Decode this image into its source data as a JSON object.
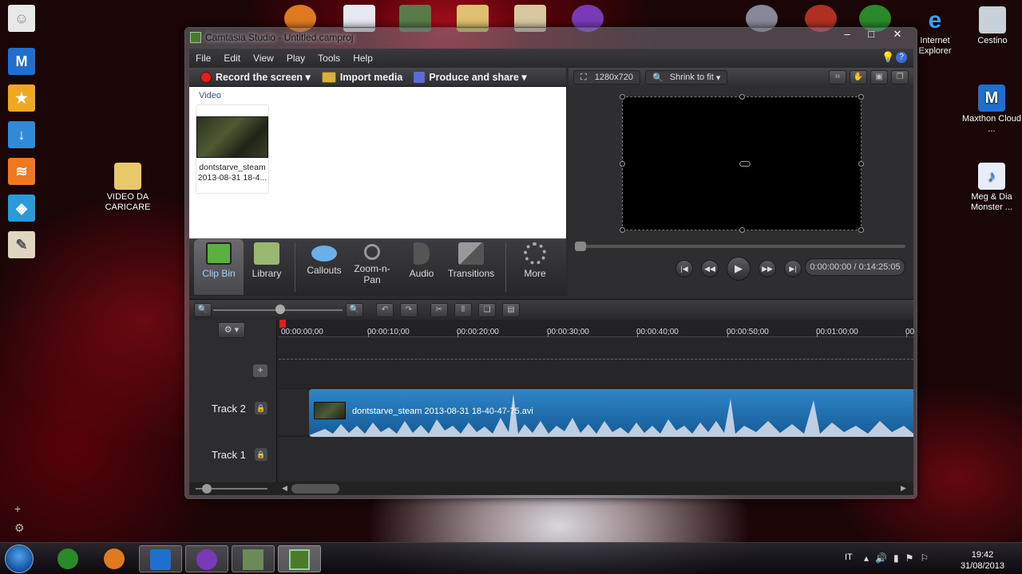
{
  "desktop": {
    "left_icons": [
      {
        "label": "VIDEO DA CARICARE"
      }
    ],
    "right_icons": [
      {
        "label": "Internet Explorer"
      },
      {
        "label": "Cestino"
      },
      {
        "label": "Maxthon Cloud ..."
      },
      {
        "label": "Meg & Dia Monster ..."
      }
    ]
  },
  "window": {
    "title": "Camtasia Studio - Untitled.camproj",
    "menu": [
      "File",
      "Edit",
      "View",
      "Play",
      "Tools",
      "Help"
    ],
    "toolbar": {
      "record": "Record the screen",
      "import": "Import media",
      "produce": "Produce and share"
    },
    "clip_bin": {
      "category": "Video",
      "items": [
        {
          "name_line1": "dontstarve_steam",
          "name_line2": "2013-08-31 18-4..."
        }
      ]
    },
    "tabs": [
      {
        "label": "Clip Bin",
        "active": true
      },
      {
        "label": "Library"
      },
      {
        "label": "Callouts"
      },
      {
        "label": "Zoom-n-Pan"
      },
      {
        "label": "Audio"
      },
      {
        "label": "Transitions"
      },
      {
        "label": "More"
      }
    ],
    "preview": {
      "resolution": "1280x720",
      "zoom": "Shrink to fit",
      "time": "0:00:00:00 / 0:14:25:05"
    },
    "timeline": {
      "ruler_labels": [
        "00:00:00;00",
        "00:00:10;00",
        "00:00:20;00",
        "00:00:30;00",
        "00:00:40;00",
        "00:00:50;00",
        "00:01:00;00",
        "00"
      ],
      "tracks": [
        {
          "name": "Track 2",
          "clip": "dontstarve_steam 2013-08-31 18-40-47-75.avi"
        },
        {
          "name": "Track 1"
        }
      ]
    }
  },
  "taskbar": {
    "language": "IT",
    "time": "19:42",
    "date": "31/08/2013"
  }
}
